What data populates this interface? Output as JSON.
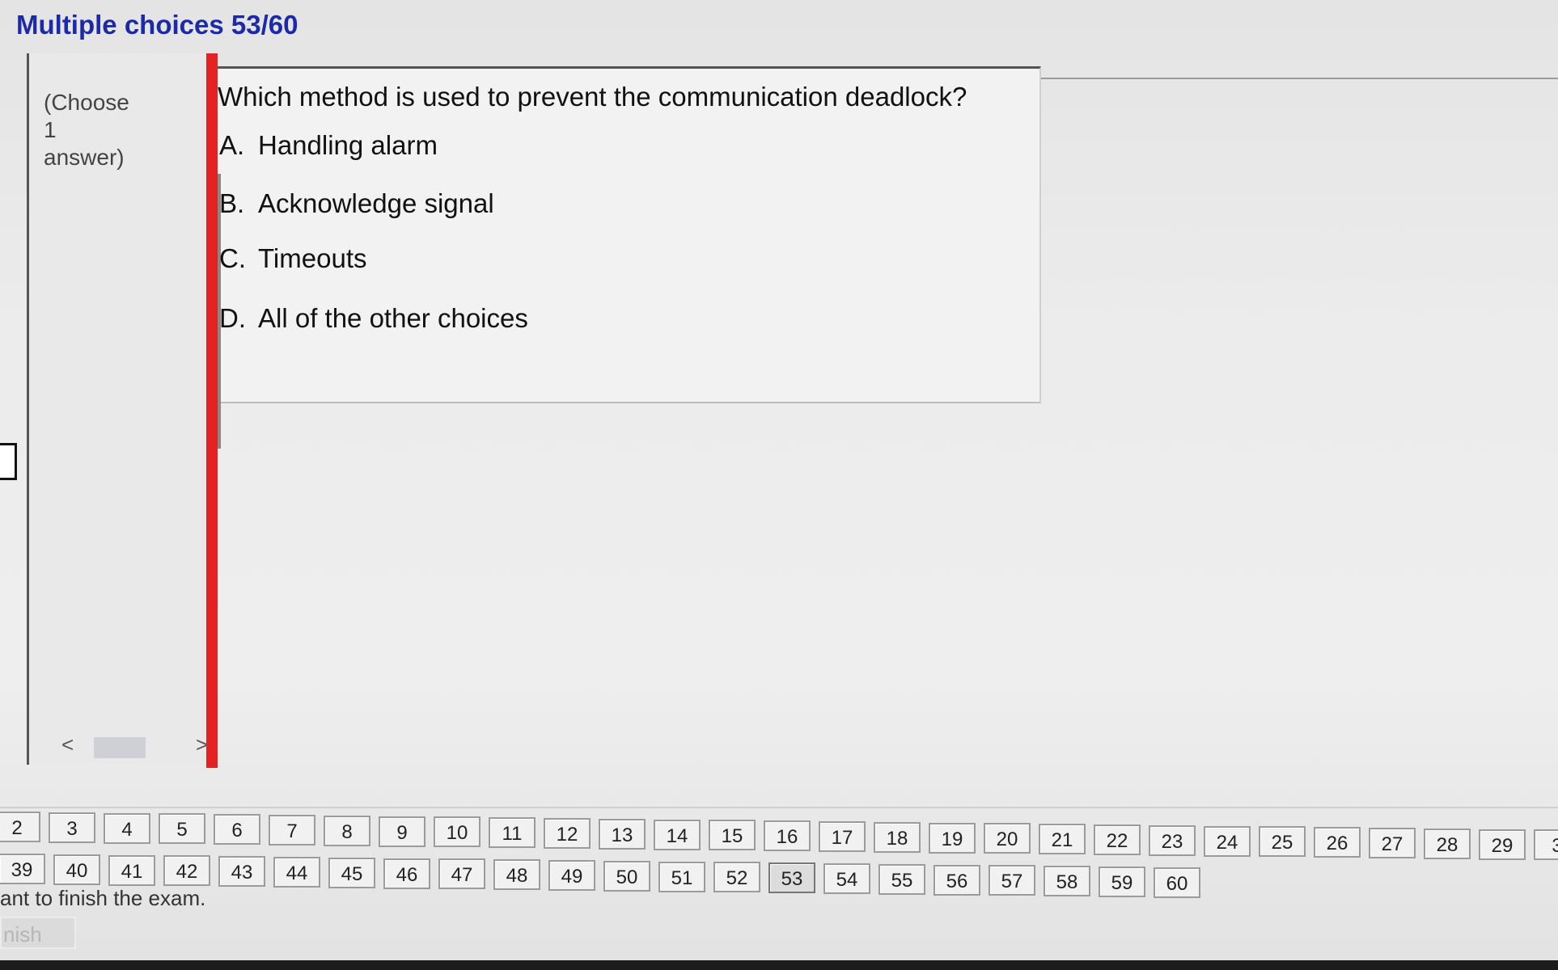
{
  "header": {
    "title": "Multiple choices 53/60"
  },
  "left_panel": {
    "hint_line1": "(Choose",
    "hint_line2": "1",
    "hint_line3": "answer)",
    "scroll_left": "<",
    "scroll_right": ">"
  },
  "question": {
    "text": "Which method is used to prevent the communication deadlock?",
    "options": [
      {
        "letter": "A.",
        "label": "Handling alarm"
      },
      {
        "letter": "B.",
        "label": "Acknowledge signal"
      },
      {
        "letter": "C.",
        "label": "Timeouts"
      },
      {
        "letter": "D.",
        "label": "All of the other choices"
      }
    ]
  },
  "navigation": {
    "row1": [
      "2",
      "3",
      "4",
      "5",
      "6",
      "7",
      "8",
      "9",
      "10",
      "11",
      "12",
      "13",
      "14",
      "15",
      "16",
      "17",
      "18",
      "19",
      "20",
      "21",
      "22",
      "23",
      "24",
      "25",
      "26",
      "27",
      "28",
      "29",
      "3"
    ],
    "row2": [
      "39",
      "40",
      "41",
      "42",
      "43",
      "44",
      "45",
      "46",
      "47",
      "48",
      "49",
      "50",
      "51",
      "52",
      "53",
      "54",
      "55",
      "56",
      "57",
      "58",
      "59",
      "60"
    ],
    "current": "53"
  },
  "footer": {
    "finish_message": "ant to finish the exam.",
    "finish_button": "nish"
  }
}
